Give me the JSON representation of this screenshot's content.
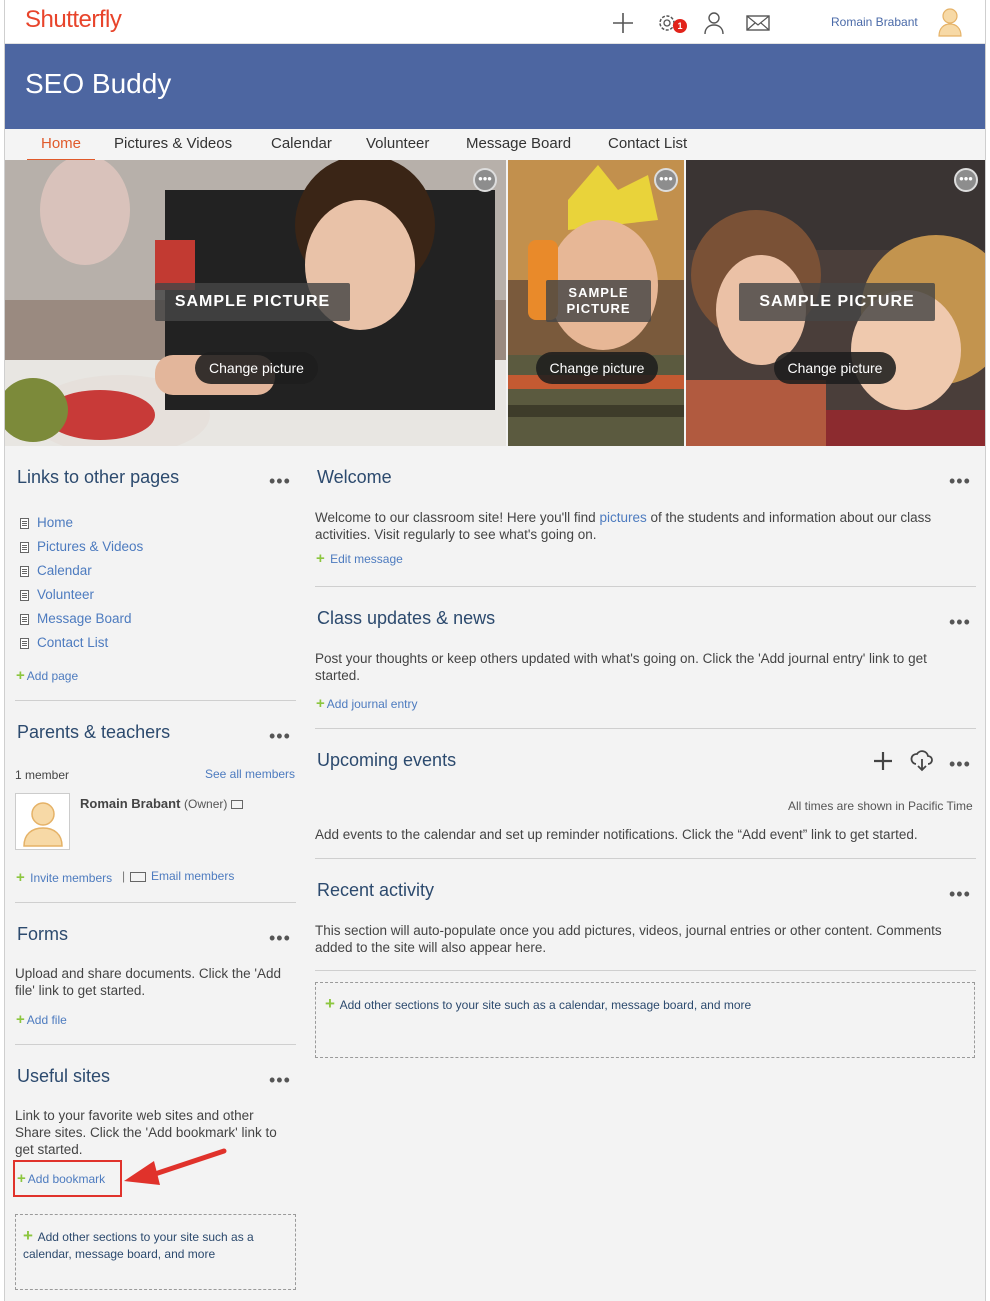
{
  "header": {
    "logo": "Shutterfly",
    "notification_count": "1",
    "user_name": "Romain Brabant",
    "icons": [
      "plus-icon",
      "gear-icon",
      "person-icon",
      "mail-icon",
      "avatar-icon"
    ]
  },
  "site": {
    "title": "SEO Buddy"
  },
  "nav": {
    "items": [
      "Home",
      "Pictures & Videos",
      "Calendar",
      "Volunteer",
      "Message Board",
      "Contact List"
    ],
    "active": "Home"
  },
  "hero": [
    {
      "caption": "SAMPLE PICTURE",
      "button": "Change picture"
    },
    {
      "caption": "SAMPLE PICTURE",
      "button": "Change picture"
    },
    {
      "caption": "SAMPLE PICTURE",
      "button": "Change picture"
    }
  ],
  "left": {
    "links": {
      "title": "Links to other pages",
      "items": [
        "Home",
        "Pictures & Videos",
        "Calendar",
        "Volunteer",
        "Message Board",
        "Contact List"
      ],
      "add": "Add page"
    },
    "parents": {
      "title": "Parents & teachers",
      "count": "1 member",
      "see_all": "See all members",
      "member_name": "Romain Brabant",
      "member_role": "(Owner)",
      "invite": "Invite members",
      "email": "Email members"
    },
    "forms": {
      "title": "Forms",
      "text": "Upload and share documents. Click the 'Add file' link to get started.",
      "add": "Add file"
    },
    "useful": {
      "title": "Useful sites",
      "text": "Link to your favorite web sites and other Share sites. Click the 'Add bookmark' link to get started.",
      "add": "Add bookmark"
    },
    "add_sections": "Add other sections to your site such as a calendar, message board, and more"
  },
  "main": {
    "welcome": {
      "title": "Welcome",
      "text_before": "Welcome to our classroom site! Here you'll find ",
      "text_link": "pictures",
      "text_after": " of the students and information about our class activities. Visit regularly to see what's going on.",
      "edit": "Edit message"
    },
    "updates": {
      "title": "Class updates & news",
      "text": "Post your thoughts or keep others updated with what's going on. Click the 'Add journal entry' link to get started.",
      "add": "Add journal entry"
    },
    "events": {
      "title": "Upcoming events",
      "timezone": "All times are shown in Pacific Time",
      "text": "Add events to the calendar and set up reminder notifications. Click the “Add event” link to get started."
    },
    "activity": {
      "title": "Recent activity",
      "text": "This section will auto-populate once you add pictures, videos, journal entries or other content. Comments added to the site will also appear here."
    },
    "add_sections": "Add other sections to your site such as a calendar, message board, and more"
  },
  "colors": {
    "brand": "#e8442b",
    "banner": "#4d66a1",
    "link": "#4d7bbf",
    "heading": "#2c4a6e",
    "highlight": "#e0322b"
  }
}
